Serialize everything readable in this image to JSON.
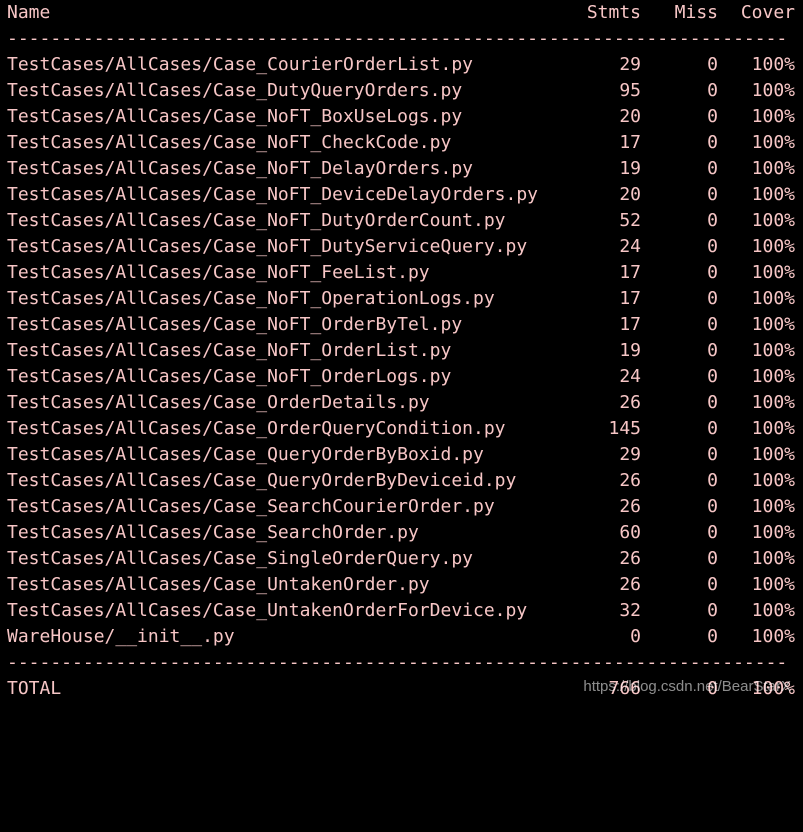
{
  "header": {
    "name": "Name",
    "stmts": "Stmts",
    "miss": "Miss",
    "cover": "Cover"
  },
  "separator": "------------------------------------------------------------------------",
  "rows": [
    {
      "name": "TestCases/AllCases/Case_CourierOrderList.py",
      "stmts": "29",
      "miss": "0",
      "cover": "100%"
    },
    {
      "name": "TestCases/AllCases/Case_DutyQueryOrders.py",
      "stmts": "95",
      "miss": "0",
      "cover": "100%"
    },
    {
      "name": "TestCases/AllCases/Case_NoFT_BoxUseLogs.py",
      "stmts": "20",
      "miss": "0",
      "cover": "100%"
    },
    {
      "name": "TestCases/AllCases/Case_NoFT_CheckCode.py",
      "stmts": "17",
      "miss": "0",
      "cover": "100%"
    },
    {
      "name": "TestCases/AllCases/Case_NoFT_DelayOrders.py",
      "stmts": "19",
      "miss": "0",
      "cover": "100%"
    },
    {
      "name": "TestCases/AllCases/Case_NoFT_DeviceDelayOrders.py",
      "stmts": "20",
      "miss": "0",
      "cover": "100%"
    },
    {
      "name": "TestCases/AllCases/Case_NoFT_DutyOrderCount.py",
      "stmts": "52",
      "miss": "0",
      "cover": "100%"
    },
    {
      "name": "TestCases/AllCases/Case_NoFT_DutyServiceQuery.py",
      "stmts": "24",
      "miss": "0",
      "cover": "100%"
    },
    {
      "name": "TestCases/AllCases/Case_NoFT_FeeList.py",
      "stmts": "17",
      "miss": "0",
      "cover": "100%"
    },
    {
      "name": "TestCases/AllCases/Case_NoFT_OperationLogs.py",
      "stmts": "17",
      "miss": "0",
      "cover": "100%"
    },
    {
      "name": "TestCases/AllCases/Case_NoFT_OrderByTel.py",
      "stmts": "17",
      "miss": "0",
      "cover": "100%"
    },
    {
      "name": "TestCases/AllCases/Case_NoFT_OrderList.py",
      "stmts": "19",
      "miss": "0",
      "cover": "100%"
    },
    {
      "name": "TestCases/AllCases/Case_NoFT_OrderLogs.py",
      "stmts": "24",
      "miss": "0",
      "cover": "100%"
    },
    {
      "name": "TestCases/AllCases/Case_OrderDetails.py",
      "stmts": "26",
      "miss": "0",
      "cover": "100%"
    },
    {
      "name": "TestCases/AllCases/Case_OrderQueryCondition.py",
      "stmts": "145",
      "miss": "0",
      "cover": "100%"
    },
    {
      "name": "TestCases/AllCases/Case_QueryOrderByBoxid.py",
      "stmts": "29",
      "miss": "0",
      "cover": "100%"
    },
    {
      "name": "TestCases/AllCases/Case_QueryOrderByDeviceid.py",
      "stmts": "26",
      "miss": "0",
      "cover": "100%"
    },
    {
      "name": "TestCases/AllCases/Case_SearchCourierOrder.py",
      "stmts": "26",
      "miss": "0",
      "cover": "100%"
    },
    {
      "name": "TestCases/AllCases/Case_SearchOrder.py",
      "stmts": "60",
      "miss": "0",
      "cover": "100%"
    },
    {
      "name": "TestCases/AllCases/Case_SingleOrderQuery.py",
      "stmts": "26",
      "miss": "0",
      "cover": "100%"
    },
    {
      "name": "TestCases/AllCases/Case_UntakenOrder.py",
      "stmts": "26",
      "miss": "0",
      "cover": "100%"
    },
    {
      "name": "TestCases/AllCases/Case_UntakenOrderForDevice.py",
      "stmts": "32",
      "miss": "0",
      "cover": "100%"
    },
    {
      "name": "WareHouse/__init__.py",
      "stmts": "0",
      "miss": "0",
      "cover": "100%"
    }
  ],
  "total": {
    "name": "TOTAL",
    "stmts": "766",
    "miss": "0",
    "cover": "100%"
  },
  "watermark": "https://blog.csdn.net/BearStarX",
  "colors": {
    "background": "#000000",
    "text": "#f7c6c6"
  }
}
